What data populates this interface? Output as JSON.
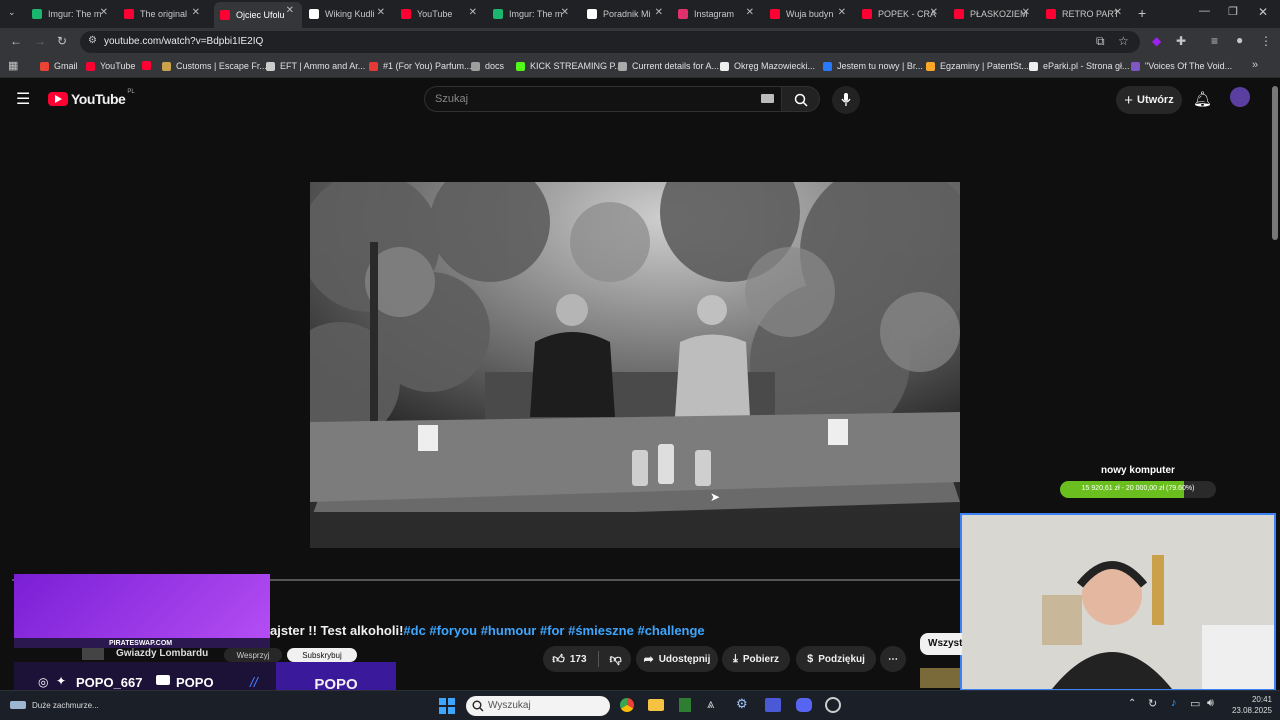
{
  "browser": {
    "tabs": [
      {
        "label": "Imgur: The m",
        "color": "#1bb76e",
        "active": false
      },
      {
        "label": "The original",
        "color": "#ff0033",
        "active": false
      },
      {
        "label": "Ojciec Ufolu",
        "color": "#ff0033",
        "active": true
      },
      {
        "label": "Wiking Kudli",
        "color": "#ffffff",
        "active": false
      },
      {
        "label": "YouTube",
        "color": "#ff0033",
        "active": false
      },
      {
        "label": "Imgur: The m",
        "color": "#1bb76e",
        "active": false
      },
      {
        "label": "Poradnik Mi",
        "color": "#ffffff",
        "active": false
      },
      {
        "label": "Instagram",
        "color": "#e1306c",
        "active": false
      },
      {
        "label": "Wuja budyn",
        "color": "#ff0033",
        "active": false
      },
      {
        "label": "POPEK - CRA",
        "color": "#ff0033",
        "active": false
      },
      {
        "label": "PŁASKOZIEM",
        "color": "#ff0033",
        "active": false
      },
      {
        "label": "RETRO PART",
        "color": "#ff0033",
        "active": false
      }
    ],
    "url": "youtube.com/watch?v=Bdpbi1IE2IQ",
    "bookmarks": [
      {
        "label": "Gmail",
        "color": "#ea4335"
      },
      {
        "label": "YouTube",
        "color": "#ff0033"
      },
      {
        "label": "",
        "color": "#ff0033"
      },
      {
        "label": "Customs | Escape Fr...",
        "color": "#c9a24b"
      },
      {
        "label": "EFT | Ammo and Ar...",
        "color": "#cccccc"
      },
      {
        "label": "#1 (For You) Parfum...",
        "color": "#e53935"
      },
      {
        "label": "docs",
        "color": "#9e9e9e"
      },
      {
        "label": "KICK STREAMING P...",
        "color": "#53fc18"
      },
      {
        "label": "Current details for A...",
        "color": "#aaaaaa"
      },
      {
        "label": "Okręg Mazowiecki...",
        "color": "#eeeeee"
      },
      {
        "label": "Jestem tu nowy | Br...",
        "color": "#2979ff"
      },
      {
        "label": "Egzaminy | PatentSt...",
        "color": "#ffa726"
      },
      {
        "label": "eParki.pl - Strona gł...",
        "color": "#eeeeee"
      },
      {
        "label": "\"Voices Of The Void...",
        "color": "#7e57c2"
      }
    ]
  },
  "youtube": {
    "logo_text": "YouTube",
    "region": "PL",
    "search_placeholder": "Szukaj",
    "create_label": "Utwórz"
  },
  "video": {
    "title": "ajster !! Test alkoholi!",
    "hashtags": "#dc #foryou #humour #for #śmieszne #challenge",
    "channel_name": "Gwiazdy Lombardu",
    "support_label": "Wesprzyj",
    "subscribe_label": "Subskrybuj",
    "likes": "173",
    "share_label": "Udostępnij",
    "download_label": "Pobierz",
    "thanks_label": "Podziękuj",
    "chip_label": "Wszyst"
  },
  "stream_overlay": {
    "sponsor": "PIRATESWAP.COM",
    "handle": "POPO_667",
    "youtube_name": "POPO",
    "brand": "POPO",
    "goal_title": "nowy komputer",
    "goal_text": "15 920,61 zł - 20 000,00 zł (79.60%)",
    "goal_progress": 0.796
  },
  "taskbar": {
    "status_text": "Duże zachmurze...",
    "search_placeholder": "Wyszukaj",
    "time": "20:41",
    "date": "23.08.2025"
  }
}
